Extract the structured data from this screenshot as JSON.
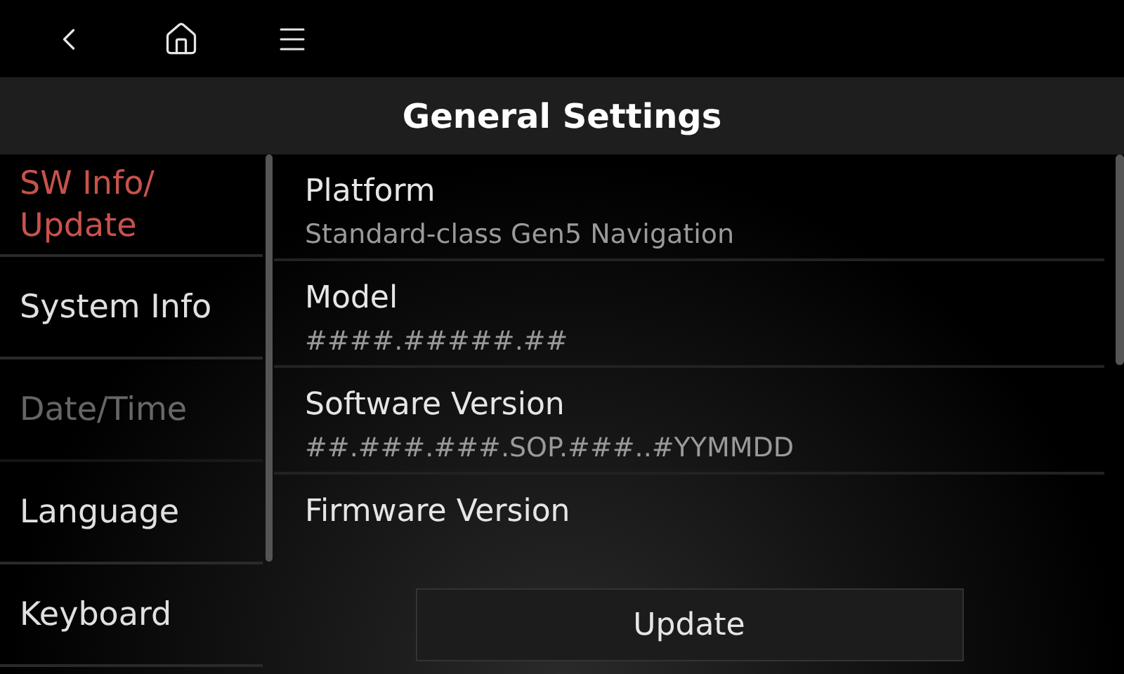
{
  "header": {
    "title": "General Settings"
  },
  "sidebar": {
    "items": [
      {
        "label": "SW Info/ Update",
        "selected": true,
        "disabled": false
      },
      {
        "label": "System Info",
        "selected": false,
        "disabled": false
      },
      {
        "label": "Date/Time",
        "selected": false,
        "disabled": true
      },
      {
        "label": "Language",
        "selected": false,
        "disabled": false
      },
      {
        "label": "Keyboard",
        "selected": false,
        "disabled": false
      }
    ]
  },
  "info": [
    {
      "label": "Platform",
      "value": "Standard-class Gen5 Navigation"
    },
    {
      "label": "Model",
      "value": "####.#####.##"
    },
    {
      "label": "Software Version",
      "value": "##.###.###.SOP.###..#YYMMDD"
    },
    {
      "label": "Firmware Version"
    }
  ],
  "update_button": "Update"
}
